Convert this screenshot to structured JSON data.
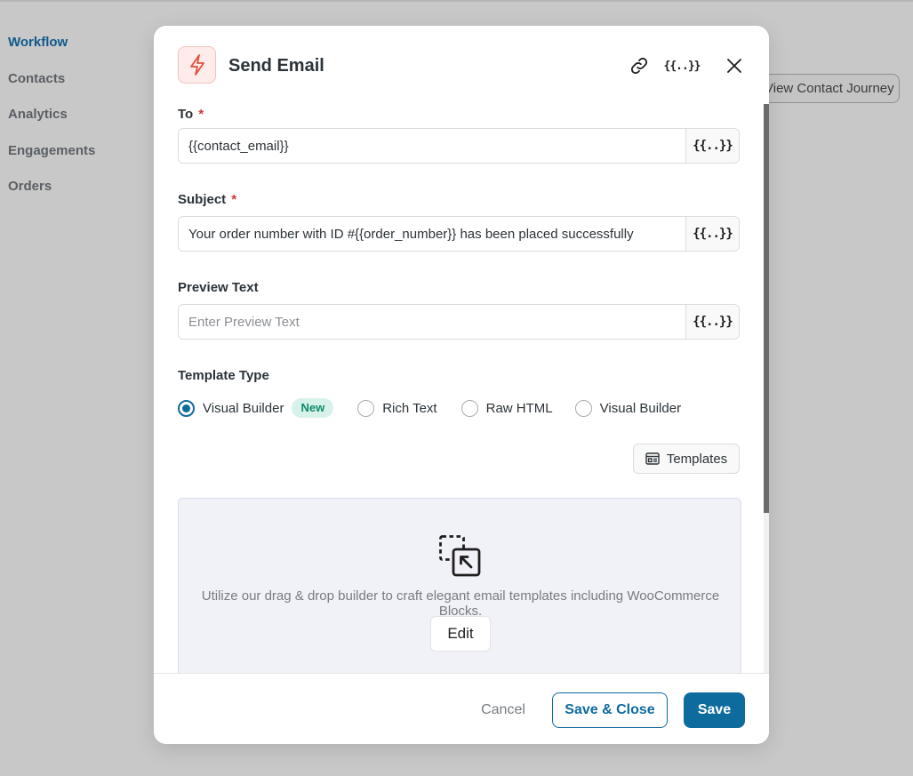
{
  "background": {
    "nav": [
      {
        "label": "Workflow",
        "active": true
      },
      {
        "label": "Contacts",
        "active": false
      },
      {
        "label": "Analytics",
        "active": false
      },
      {
        "label": "Engagements",
        "active": false
      },
      {
        "label": "Orders",
        "active": false
      }
    ],
    "journey_button": "View Contact Journey"
  },
  "modal": {
    "title": "Send Email",
    "header_icon": "lightning-icon",
    "header_actions": {
      "link_icon": "link-icon",
      "merge_tag_label": "{{..}}",
      "close_icon": "close-icon"
    },
    "fields": {
      "to": {
        "label": "To",
        "required_mark": "*",
        "value": "{{contact_email}}",
        "merge_label": "{{..}}"
      },
      "subject": {
        "label": "Subject",
        "required_mark": "*",
        "value": "Your order number with ID #{{order_number}} has been placed successfully",
        "merge_label": "{{..}}"
      },
      "preview": {
        "label": "Preview Text",
        "value": "",
        "placeholder": "Enter Preview Text",
        "merge_label": "{{..}}"
      }
    },
    "template_type": {
      "label": "Template Type",
      "options": [
        {
          "label": "Visual Builder",
          "checked": true,
          "badge": "New"
        },
        {
          "label": "Rich Text",
          "checked": false
        },
        {
          "label": "Raw HTML",
          "checked": false
        },
        {
          "label": "Visual Builder",
          "checked": false
        }
      ]
    },
    "templates_button": "Templates",
    "builder": {
      "icon": "drag-drop-icon",
      "description": "Utilize our drag & drop builder to craft elegant email templates including WooCommerce Blocks.",
      "edit_label": "Edit"
    },
    "footer": {
      "cancel": "Cancel",
      "save_close": "Save & Close",
      "save": "Save"
    }
  },
  "colors": {
    "primary": "#0e6b9e",
    "required": "#d63638",
    "badge_bg": "#d6f2ea",
    "badge_text": "#0f8a68",
    "icon_accent": "#e0513f"
  }
}
